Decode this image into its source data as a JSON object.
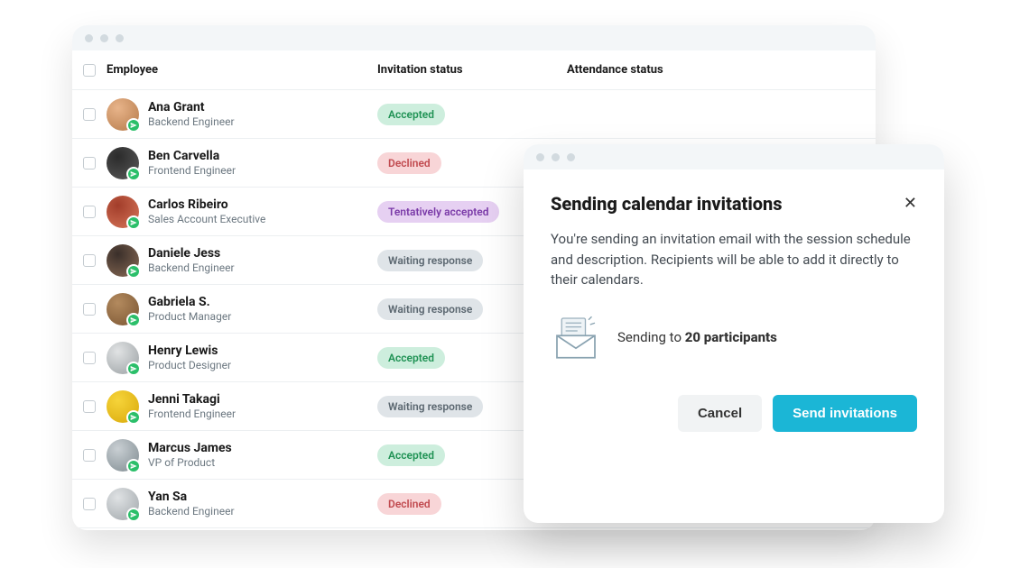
{
  "table": {
    "headers": {
      "employee": "Employee",
      "invitation": "Invitation status",
      "attendance": "Attendance status"
    },
    "employees": [
      {
        "name": "Ana Grant",
        "role": "Backend Engineer",
        "status": "Accepted",
        "statusKind": "accepted",
        "avatarGrad": [
          "#e8b48a",
          "#b57a4a"
        ]
      },
      {
        "name": "Ben Carvella",
        "role": "Frontend Engineer",
        "status": "Declined",
        "statusKind": "declined",
        "avatarGrad": [
          "#2b2b2b",
          "#5a5a5a"
        ]
      },
      {
        "name": "Carlos Ribeiro",
        "role": "Sales Account Executive",
        "status": "Tentatively accepted",
        "statusKind": "tentative",
        "avatarGrad": [
          "#a23d2a",
          "#d7765a"
        ]
      },
      {
        "name": "Daniele Jess",
        "role": "Backend Engineer",
        "status": "Waiting response",
        "statusKind": "waiting",
        "avatarGrad": [
          "#3a2f2a",
          "#8a6b55"
        ]
      },
      {
        "name": "Gabriela S.",
        "role": "Product Manager",
        "status": "Waiting response",
        "statusKind": "waiting",
        "avatarGrad": [
          "#b38a5e",
          "#7a5532"
        ]
      },
      {
        "name": "Henry Lewis",
        "role": "Product Designer",
        "status": "Accepted",
        "statusKind": "accepted",
        "avatarGrad": [
          "#e1e3e4",
          "#9aa0a3"
        ]
      },
      {
        "name": "Jenni Takagi",
        "role": "Frontend Engineer",
        "status": "Waiting response",
        "statusKind": "waiting",
        "avatarGrad": [
          "#f6d43a",
          "#d9a90a"
        ]
      },
      {
        "name": "Marcus James",
        "role": "VP of Product",
        "status": "Accepted",
        "statusKind": "accepted",
        "avatarGrad": [
          "#c9cfd3",
          "#7f8b91"
        ]
      },
      {
        "name": "Yan Sa",
        "role": "Backend Engineer",
        "status": "Declined",
        "statusKind": "declined",
        "avatarGrad": [
          "#dfe2e4",
          "#a0a6aa"
        ]
      }
    ]
  },
  "modal": {
    "title": "Sending calendar invitations",
    "description": "You're sending an invitation email with the session schedule and description. Recipients will be able to add it directly to their calendars.",
    "sending_prefix": "Sending to ",
    "participant_count": "20 participants",
    "cancel": "Cancel",
    "send": "Send invitations"
  }
}
